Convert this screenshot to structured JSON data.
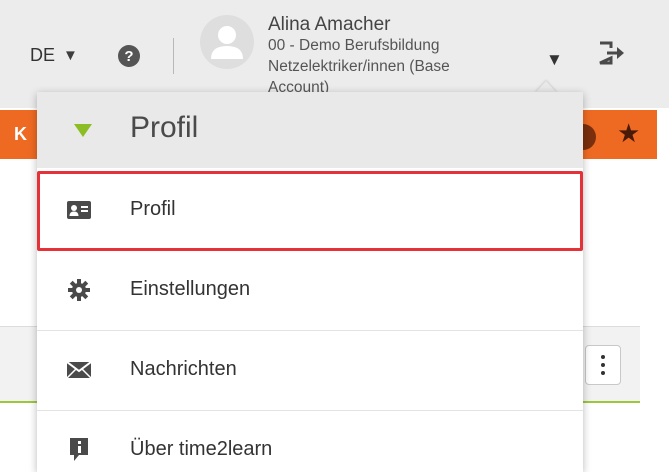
{
  "header": {
    "language": "DE",
    "user": {
      "name": "Alina Amacher",
      "line1": "00 - Demo Berufsbildung",
      "line2": "Netzelektriker/innen (Base",
      "line3": "Account)"
    }
  },
  "nav": {
    "partial_label": "K"
  },
  "dropdown": {
    "title": "Profil",
    "items": [
      {
        "label": "Profil",
        "icon": "id-card-icon",
        "selected": true
      },
      {
        "label": "Einstellungen",
        "icon": "gear-icon"
      },
      {
        "label": "Nachrichten",
        "icon": "envelope-icon"
      },
      {
        "label": "Über time2learn",
        "icon": "info-icon"
      }
    ]
  },
  "colors": {
    "accent_green": "#8cbd25",
    "nav_orange": "#ee6a22",
    "selection_red": "#e53238"
  }
}
